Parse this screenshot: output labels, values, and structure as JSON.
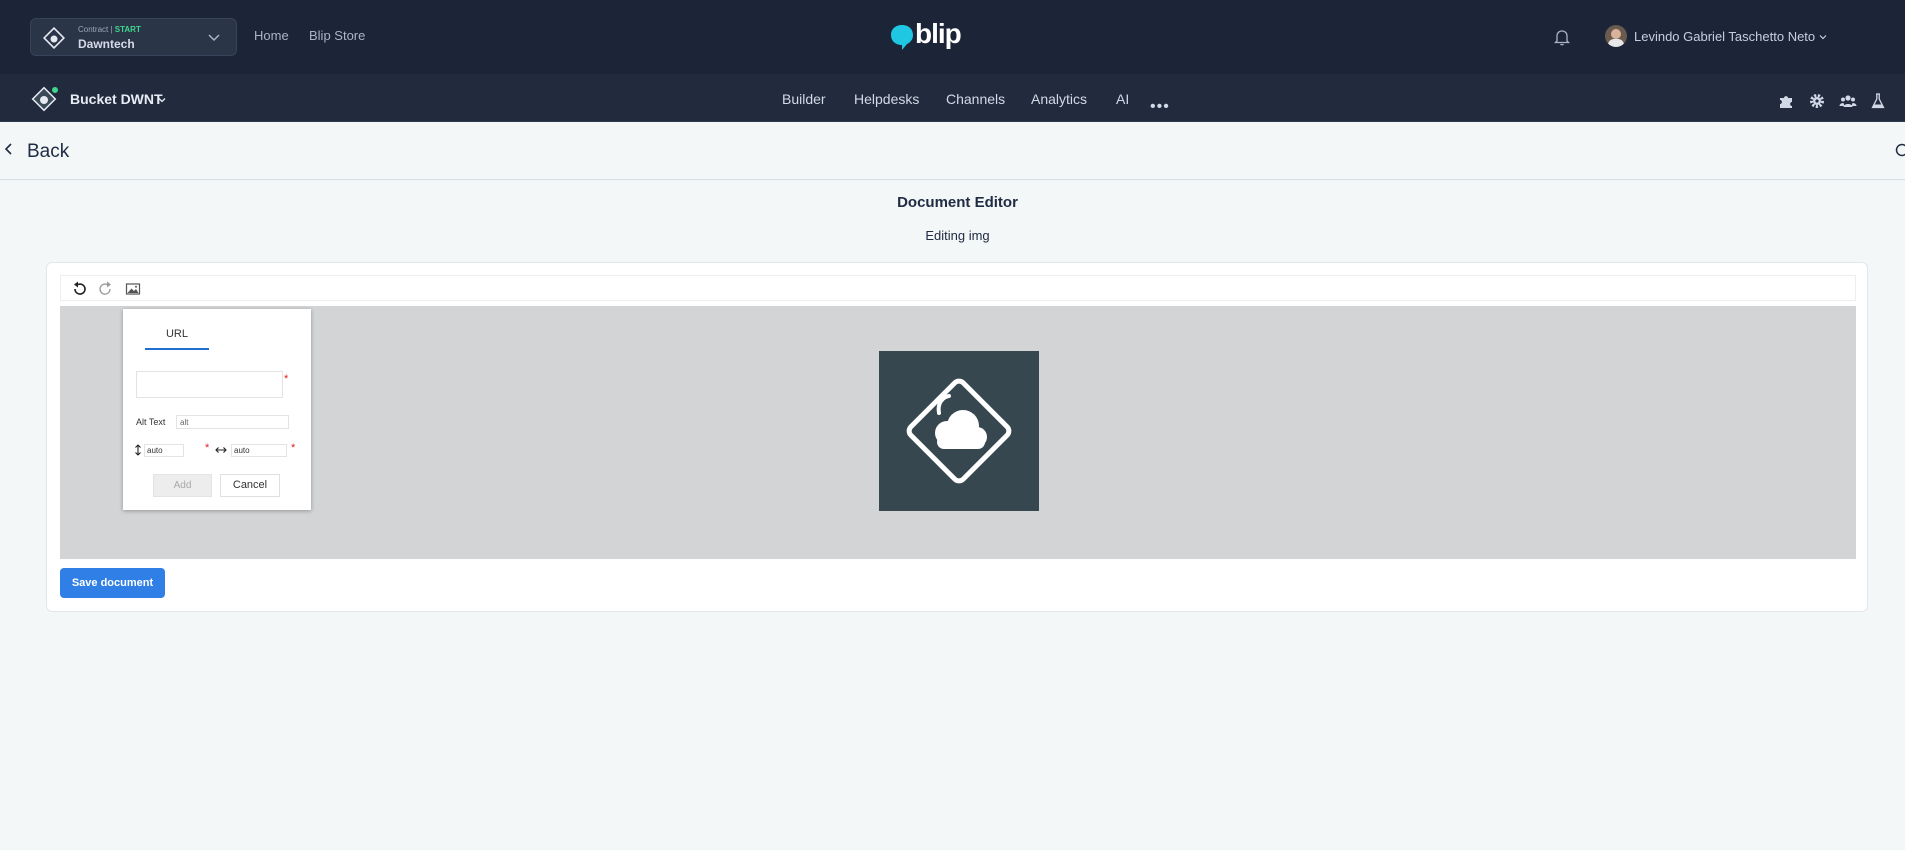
{
  "topbar": {
    "contract_prefix": "Contract | ",
    "contract_plan": "START",
    "contract_name": "Dawntech",
    "links": [
      "Home",
      "Blip Store"
    ],
    "brand": "blip",
    "user_name": "Levindo Gabriel Taschetto Neto"
  },
  "navbar": {
    "bot_name": "Bucket DWNT",
    "links": [
      "Builder",
      "Helpdesks",
      "Channels",
      "Analytics",
      "AI"
    ],
    "more": "•••",
    "right_icons": [
      "puzzle-icon",
      "gear-icon",
      "team-icon",
      "flask-icon"
    ]
  },
  "header": {
    "back_label": "Back"
  },
  "page": {
    "title": "Document Editor",
    "subtitle": "Editing img"
  },
  "toolbar": {
    "icons": [
      "undo-icon",
      "redo-icon",
      "image-icon"
    ]
  },
  "image_dialog": {
    "tab_label": "URL",
    "url_value": "",
    "alt_label": "Alt Text",
    "alt_value": "alt",
    "height_value": "auto",
    "width_value": "auto",
    "required_mark": "*",
    "add_label": "Add",
    "cancel_label": "Cancel"
  },
  "footer": {
    "save_label": "Save document"
  },
  "colors": {
    "topbar": "#1c2537",
    "navbar": "#222b3e",
    "accent": "#2f7fe6",
    "image_bg": "#36474f",
    "editor_bg": "#d3d4d6"
  }
}
